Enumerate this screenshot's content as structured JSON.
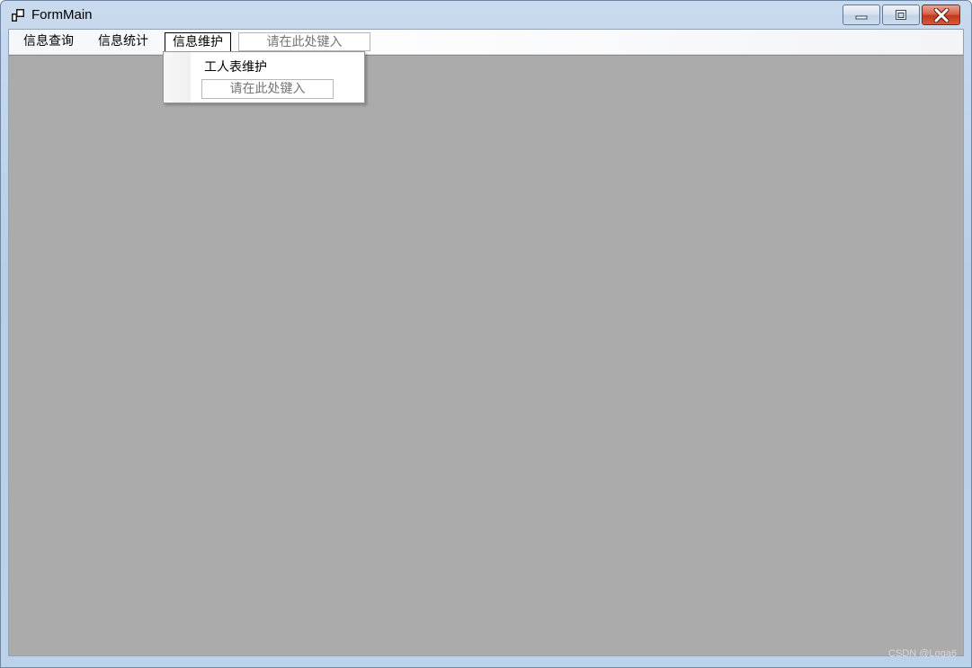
{
  "window": {
    "title": "FormMain",
    "icon": "app-window-icon",
    "caption_buttons": [
      "minimize-icon",
      "maximize-icon",
      "close-icon"
    ]
  },
  "menubar": {
    "items": [
      {
        "label": "信息查询"
      },
      {
        "label": "信息统计"
      },
      {
        "label": "信息维护"
      }
    ],
    "type_here_placeholder": "请在此处键入"
  },
  "dropdown": {
    "items": [
      {
        "label": "工人表维护"
      }
    ],
    "type_here_placeholder": "请在此处键入"
  },
  "watermark": "CSDN @Loga6",
  "colors": {
    "mdi_background": "#ababab",
    "close_button": "#c9462c",
    "titlebar": "#bcd2ea"
  }
}
